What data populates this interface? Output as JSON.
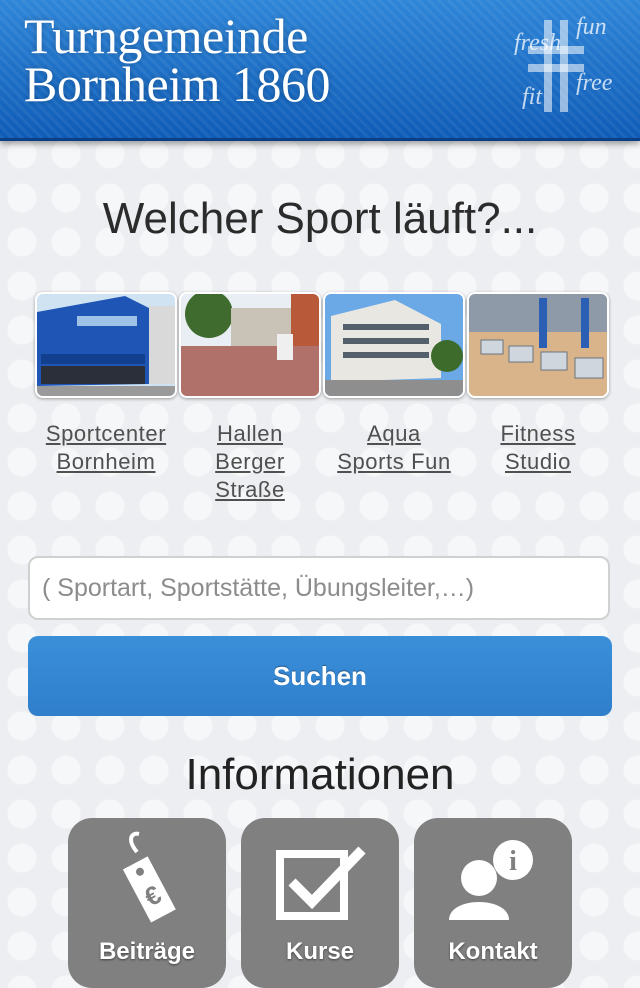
{
  "header": {
    "club_name_line1": "Turngemeinde",
    "club_name_line2": "Bornheim 1860",
    "logo_words": [
      "fresh",
      "fun",
      "fit",
      "free"
    ]
  },
  "main": {
    "title": "Welcher Sport läuft?...",
    "venues": [
      {
        "line1": "Sportcenter",
        "line2": "Bornheim",
        "line3": "",
        "image": "building-photo"
      },
      {
        "line1": "Hallen",
        "line2": "Berger",
        "line3": "Straße",
        "image": "courtyard-photo"
      },
      {
        "line1": "Aqua",
        "line2": "Sports Fun",
        "line3": "",
        "image": "pool-building-photo"
      },
      {
        "line1": "Fitness",
        "line2": "Studio",
        "line3": "",
        "image": "gym-photo"
      }
    ],
    "search": {
      "placeholder": "( Sportart, Sportstätte, Übungsleiter,…)",
      "value": ""
    },
    "search_button_label": "Suchen"
  },
  "info": {
    "title": "Informationen",
    "tiles": [
      {
        "label": "Beiträge",
        "icon": "price-tag-euro-icon"
      },
      {
        "label": "Kurse",
        "icon": "checkbox-icon"
      },
      {
        "label": "Kontakt",
        "icon": "contact-info-icon"
      }
    ]
  },
  "colors": {
    "header_blue": "#1a6cc6",
    "button_blue": "#3386d3",
    "tile_gray": "#808080",
    "background": "#eceef1"
  }
}
